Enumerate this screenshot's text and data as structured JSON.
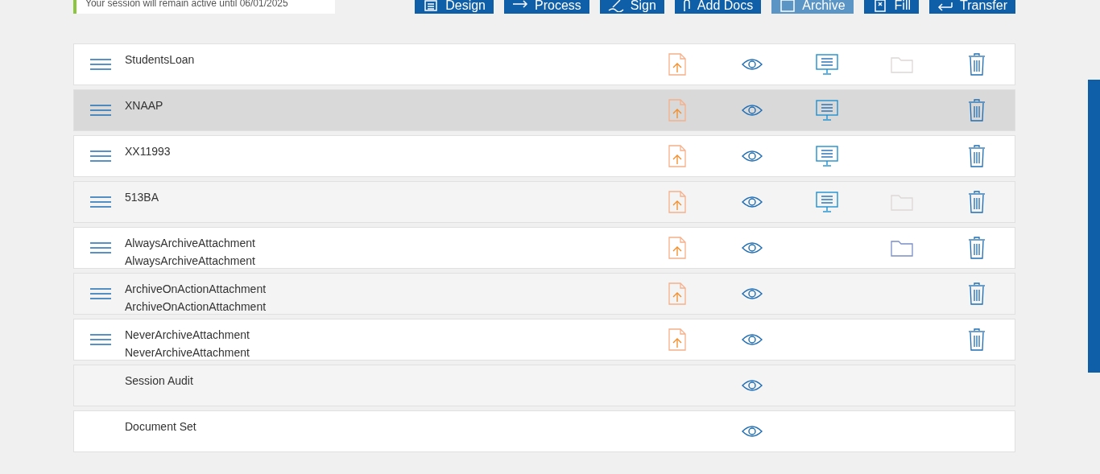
{
  "session_notice": "Your session will remain active until 06/01/2025",
  "toolbar": [
    {
      "label": "Design",
      "disabled": false
    },
    {
      "label": "Process",
      "disabled": false
    },
    {
      "label": "Sign",
      "disabled": false
    },
    {
      "label": "Add Docs",
      "disabled": false
    },
    {
      "label": "Archive",
      "disabled": true
    },
    {
      "label": "Fill",
      "disabled": false
    },
    {
      "label": "Transfer",
      "disabled": false
    }
  ],
  "documents": [
    {
      "lines": [
        "StudentsLoan"
      ],
      "selected": false,
      "drag": true,
      "upload": true,
      "view": true,
      "present": true,
      "folder": true,
      "folder_disabled": true,
      "delete": true
    },
    {
      "lines": [
        "XNAAP"
      ],
      "selected": true,
      "drag": true,
      "upload": true,
      "view": true,
      "present": true,
      "folder": false,
      "delete": true
    },
    {
      "lines": [
        "XX11993"
      ],
      "selected": false,
      "drag": true,
      "upload": true,
      "view": true,
      "present": true,
      "folder": false,
      "delete": true
    },
    {
      "lines": [
        "513BA"
      ],
      "selected": false,
      "drag": true,
      "upload": true,
      "view": true,
      "present": true,
      "folder": true,
      "folder_disabled": true,
      "delete": true
    },
    {
      "lines": [
        "AlwaysArchiveAttachment",
        "AlwaysArchiveAttachment"
      ],
      "selected": false,
      "drag": true,
      "upload": true,
      "view": true,
      "present": false,
      "folder": true,
      "folder_disabled": false,
      "delete": true
    },
    {
      "lines": [
        "ArchiveOnActionAttachment",
        "ArchiveOnActionAttachment"
      ],
      "selected": false,
      "drag": true,
      "upload": true,
      "view": true,
      "present": false,
      "folder": false,
      "delete": true
    },
    {
      "lines": [
        "NeverArchiveAttachment",
        "NeverArchiveAttachment"
      ],
      "selected": false,
      "drag": true,
      "upload": true,
      "view": true,
      "present": false,
      "folder": false,
      "delete": true
    },
    {
      "lines": [
        "Session Audit"
      ],
      "selected": false,
      "drag": false,
      "upload": false,
      "view": true,
      "present": false,
      "folder": false,
      "delete": false
    },
    {
      "lines": [
        "Document Set"
      ],
      "selected": false,
      "drag": false,
      "upload": false,
      "view": true,
      "present": false,
      "folder": false,
      "delete": false
    }
  ]
}
